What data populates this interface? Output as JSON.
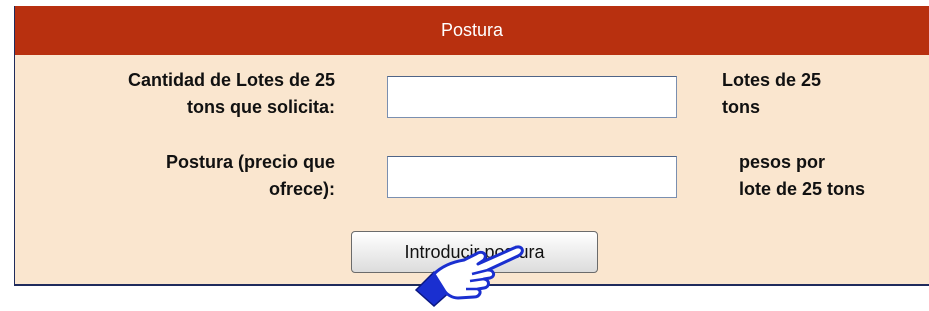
{
  "panel": {
    "title": "Postura",
    "header_color": "#b8300f",
    "background_color": "#fae6cf"
  },
  "quantity": {
    "label_line1": "Cantidad de Lotes de 25",
    "label_line2": "tons que solicita:",
    "value": "",
    "unit_line1": "Lotes de 25",
    "unit_line2": "tons"
  },
  "bid": {
    "label_line1": "Postura (precio que",
    "label_line2": "ofrece):",
    "value": "",
    "unit_line1": "pesos por",
    "unit_line2": "lote de 25 tons"
  },
  "submit": {
    "label": "Introducir postura"
  },
  "cursor": {
    "icon": "hand-pointer-icon"
  }
}
